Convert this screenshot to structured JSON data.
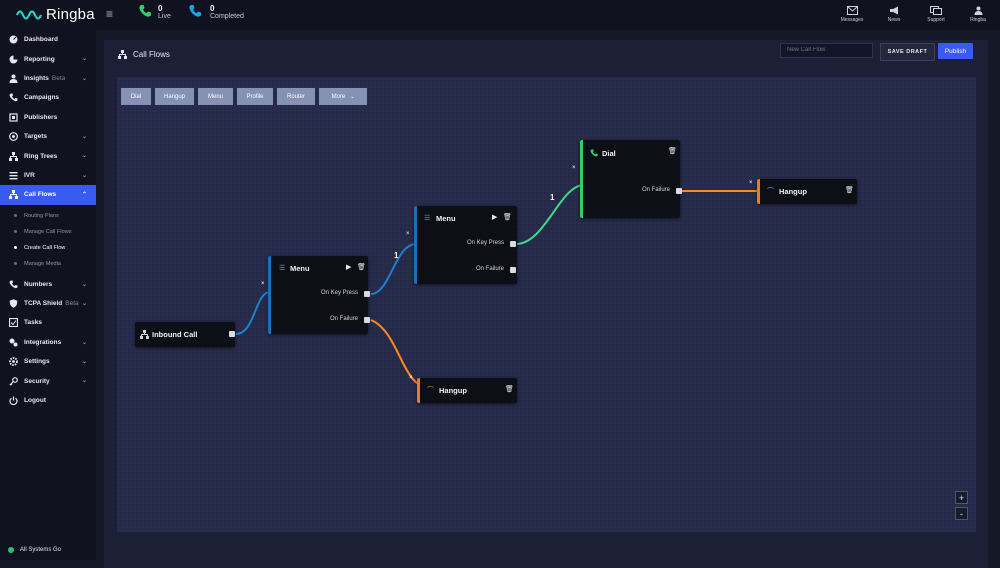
{
  "app": {
    "name": "Ringba"
  },
  "top_stats": [
    {
      "value": "0",
      "label": "Live"
    },
    {
      "value": "0",
      "label": "Completed"
    }
  ],
  "top_actions": [
    {
      "label": "Messages",
      "icon": "envelope-icon"
    },
    {
      "label": "News",
      "icon": "megaphone-icon"
    },
    {
      "label": "Support",
      "icon": "support-icon"
    },
    {
      "label": "Ringba",
      "icon": "user-icon"
    }
  ],
  "sidebar": {
    "items": [
      {
        "label": "Dashboard",
        "icon": "dashboard-icon",
        "chevron": false
      },
      {
        "label": "Reporting",
        "icon": "chart-icon",
        "chevron": true
      },
      {
        "label": "Insights",
        "beta": "Beta",
        "icon": "users-icon",
        "chevron": true
      },
      {
        "label": "Campaigns",
        "icon": "phone-icon",
        "chevron": false
      },
      {
        "label": "Publishers",
        "icon": "publisher-icon",
        "chevron": false
      },
      {
        "label": "Targets",
        "icon": "target-icon",
        "chevron": true
      },
      {
        "label": "Ring Trees",
        "icon": "tree-icon",
        "chevron": true
      },
      {
        "label": "IVR",
        "icon": "ivr-icon",
        "chevron": true
      },
      {
        "label": "Call Flows",
        "icon": "flow-icon",
        "chevron": true,
        "active": true
      }
    ],
    "sub_items": [
      {
        "label": "Routing Plans",
        "current": false
      },
      {
        "label": "Manage Call Flows",
        "current": false
      },
      {
        "label": "Create Call Flow",
        "current": true
      },
      {
        "label": "Manage Media",
        "current": false
      }
    ],
    "items_after": [
      {
        "label": "Numbers",
        "icon": "numbers-icon",
        "chevron": true
      },
      {
        "label": "TCPA Shield",
        "beta": "Beta",
        "icon": "shield-icon",
        "chevron": true
      },
      {
        "label": "Tasks",
        "icon": "tasks-icon",
        "chevron": false
      },
      {
        "label": "Integrations",
        "icon": "integrations-icon",
        "chevron": true
      },
      {
        "label": "Settings",
        "icon": "gear-icon",
        "chevron": true
      },
      {
        "label": "Security",
        "icon": "key-icon",
        "chevron": true
      },
      {
        "label": "Logout",
        "icon": "power-icon",
        "chevron": false
      }
    ],
    "status": "All Systems Go"
  },
  "page": {
    "title": "Call Flows",
    "flow_name_placeholder": "New Call Flow",
    "save_draft_label": "SAVE DRAFT",
    "publish_label": "Publish"
  },
  "toolbar": [
    {
      "label": "Dial"
    },
    {
      "label": "Hangup"
    },
    {
      "label": "Menu"
    },
    {
      "label": "Profile"
    },
    {
      "label": "Router"
    },
    {
      "label": "More",
      "dropdown": true
    }
  ],
  "nodes": {
    "inbound": {
      "title": "Inbound Call"
    },
    "menu1": {
      "title": "Menu",
      "ports": [
        "On Key Press",
        "On Failure"
      ]
    },
    "menu2": {
      "title": "Menu",
      "ports": [
        "On Key Press",
        "On Failure"
      ]
    },
    "dial": {
      "title": "Dial",
      "ports": [
        "On Failure"
      ]
    },
    "hangup1": {
      "title": "Hangup"
    },
    "hangup2": {
      "title": "Hangup"
    }
  },
  "edge_labels": {
    "menu1_keypress": "1",
    "menu2_keypress": "1"
  },
  "colors": {
    "accent": "#3a5bf0",
    "menu_bar": "#1d6fb8",
    "dial_bar": "#2fcf6d",
    "hangup_bar": "#f07a16",
    "edge_blue": "#1f7fd0",
    "edge_green": "#3ddc84",
    "edge_orange": "#ff8a1a"
  },
  "zoom": {
    "in": "+",
    "out": "-"
  }
}
